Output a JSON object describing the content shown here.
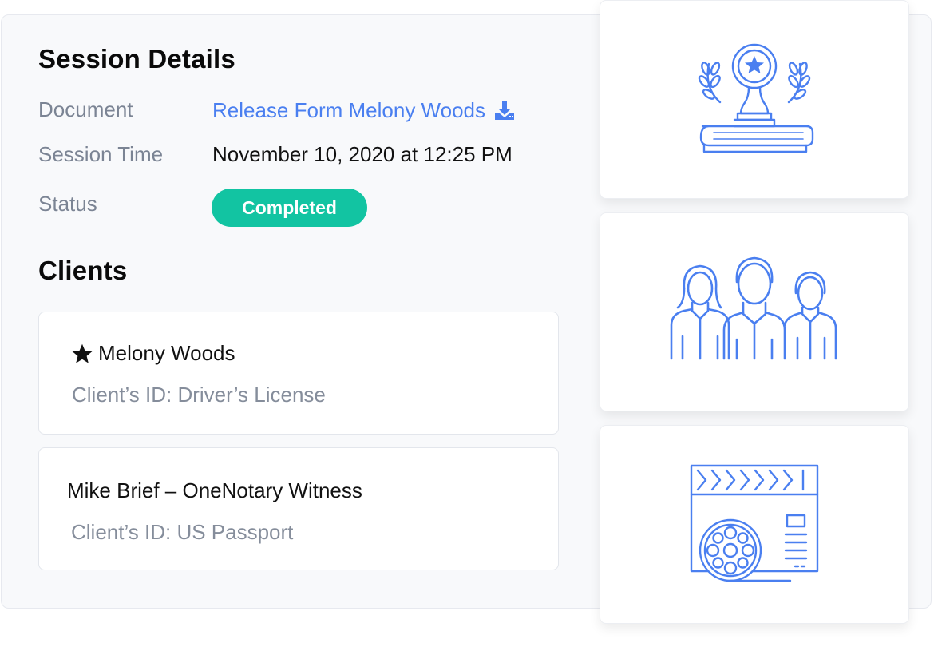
{
  "session": {
    "title": "Session Details",
    "document_label": "Document",
    "document_value": "Release Form Melony Woods",
    "time_label": "Session Time",
    "time_value": "November 10, 2020 at 12:25 PM",
    "status_label": "Status",
    "status_value": "Completed"
  },
  "clients": {
    "title": "Clients",
    "items": [
      {
        "name": "Melony Woods",
        "id_text": "Client’s ID: Driver’s License",
        "icon": "star-icon"
      },
      {
        "name": "Mike Brief – OneNotary Witness",
        "id_text": "Client’s ID: US Passport"
      }
    ]
  },
  "tiles": [
    "trophy-award-icon",
    "people-group-icon",
    "film-clapperboard-icon"
  ],
  "colors": {
    "accent": "#4a7ff0",
    "status_green": "#12c4a2",
    "muted": "#7b8494"
  }
}
